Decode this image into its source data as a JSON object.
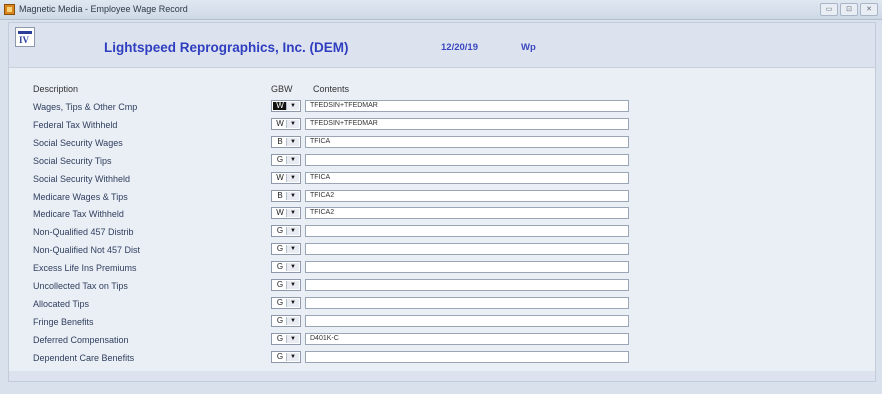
{
  "window": {
    "title": "Magnetic Media - Employee Wage Record",
    "minimize_label": "▭",
    "maximize_label": "⊡",
    "close_label": "✕"
  },
  "header": {
    "company": "Lightspeed Reprographics, Inc. (DEM)",
    "date": "12/20/19",
    "user": "Wp"
  },
  "columns": {
    "description": "Description",
    "gbw": "GBW",
    "contents": "Contents"
  },
  "rows": [
    {
      "label": "Wages, Tips & Other Cmp",
      "gbw": "W",
      "contents": "TFEDSIN+TFEDMAR",
      "selected": true
    },
    {
      "label": "Federal Tax Withheld",
      "gbw": "W",
      "contents": "TFEDSIN+TFEDMAR"
    },
    {
      "label": "Social Security Wages",
      "gbw": "B",
      "contents": "TFICA"
    },
    {
      "label": "Social Security Tips",
      "gbw": "G",
      "contents": ""
    },
    {
      "label": "Social Security Withheld",
      "gbw": "W",
      "contents": "TFICA"
    },
    {
      "label": "Medicare Wages & Tips",
      "gbw": "B",
      "contents": "TFICA2"
    },
    {
      "label": "Medicare Tax Withheld",
      "gbw": "W",
      "contents": "TFICA2"
    },
    {
      "label": "Non-Qualified 457 Distrib",
      "gbw": "G",
      "contents": ""
    },
    {
      "label": "Non-Qualified Not 457 Dist",
      "gbw": "G",
      "contents": ""
    },
    {
      "label": "Excess Life Ins Premiums",
      "gbw": "G",
      "contents": ""
    },
    {
      "label": "Uncollected Tax on Tips",
      "gbw": "G",
      "contents": ""
    },
    {
      "label": "Allocated Tips",
      "gbw": "G",
      "contents": ""
    },
    {
      "label": "Fringe Benefits",
      "gbw": "G",
      "contents": ""
    },
    {
      "label": "Deferred Compensation",
      "gbw": "G",
      "contents": "D401K-C"
    },
    {
      "label": "Dependent Care Benefits",
      "gbw": "G",
      "contents": ""
    }
  ]
}
